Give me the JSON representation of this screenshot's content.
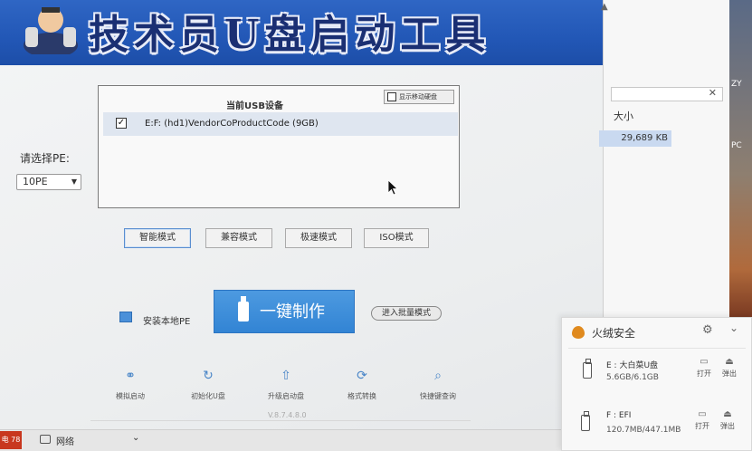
{
  "banner": {
    "title": "技术员U盘启动工具"
  },
  "pe": {
    "label": "请选择PE:",
    "selected": "10PE"
  },
  "usb": {
    "header": "当前USB设备",
    "show_mobile_label": "显示移动硬盘",
    "device": "E:F: (hd1)VendorCoProductCode (9GB)",
    "device_checked": "✓"
  },
  "modes": {
    "smart": "智能模式",
    "compat": "兼容模式",
    "fast": "极速模式",
    "iso": "ISO模式"
  },
  "actions": {
    "install_local": "安装本地PE",
    "make": "一键制作",
    "batch": "进入批量模式"
  },
  "tools": {
    "simulate": "模拟启动",
    "init": "初始化U盘",
    "upgrade": "升级启动盘",
    "convert": "格式转换",
    "shortcut": "快捷键查询"
  },
  "version": "V.8.7.4.8.0",
  "background_window": {
    "size_header": "大小",
    "size_value": "29,689 KB"
  },
  "desktop": {
    "label1": "PC",
    "label2": "ZY"
  },
  "taskbar": {
    "network_label": "网络",
    "start_tag": "电 78",
    "caret": "⌄"
  },
  "huorong": {
    "title": "火绒安全",
    "drives": [
      {
        "name": "E : 大白菜U盘",
        "size": "5.6GB/6.1GB",
        "open": "打开",
        "eject": "弹出"
      },
      {
        "name": "F : EFI",
        "size": "120.7MB/447.1MB",
        "open": "打开",
        "eject": "弹出"
      }
    ]
  },
  "colors": {
    "banner_blue": "#2257b6",
    "button_blue": "#3284d4",
    "selection": "#dfe6f0"
  }
}
